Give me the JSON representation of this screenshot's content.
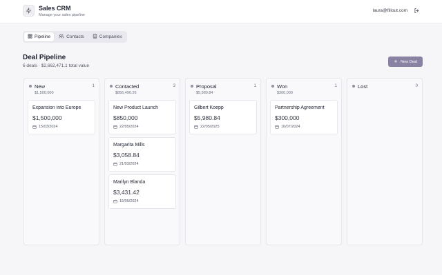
{
  "header": {
    "title": "Sales CRM",
    "subtitle": "Manage your sales pipeline",
    "user_email": "laura@fillout.com",
    "logo_icon": "lightning-icon",
    "logout_icon": "logout-icon"
  },
  "tabs": [
    {
      "label": "Pipeline",
      "icon": "grid-icon",
      "active": true
    },
    {
      "label": "Contacts",
      "icon": "users-icon",
      "active": false
    },
    {
      "label": "Companies",
      "icon": "building-icon",
      "active": false
    }
  ],
  "page": {
    "title": "Deal Pipeline",
    "summary": "6 deals · $2,662,471.1 total value",
    "new_deal_label": "New Deal"
  },
  "columns": [
    {
      "name": "New",
      "count": "1",
      "total": "$1,500,000",
      "deals": [
        {
          "name": "Expansion into Europe",
          "value": "$1,500,000",
          "date": "15/03/2024"
        }
      ]
    },
    {
      "name": "Contacted",
      "count": "3",
      "total": "$856,490.26",
      "deals": [
        {
          "name": "New Product Launch",
          "value": "$850,000",
          "date": "22/05/2024"
        },
        {
          "name": "Margarita Mills",
          "value": "$3,058.84",
          "date": "21/03/2024"
        },
        {
          "name": "Marilyn Blanda",
          "value": "$3,431.42",
          "date": "15/05/2024"
        }
      ]
    },
    {
      "name": "Proposal",
      "count": "1",
      "total": "$5,980.84",
      "deals": [
        {
          "name": "Gilbert Koepp",
          "value": "$5,980.84",
          "date": "22/05/2025"
        }
      ]
    },
    {
      "name": "Won",
      "count": "1",
      "total": "$300,000",
      "deals": [
        {
          "name": "Partnership Agreement",
          "value": "$300,000",
          "date": "10/07/2024"
        }
      ]
    },
    {
      "name": "Lost",
      "count": "0",
      "total": "",
      "deals": []
    }
  ],
  "colors": {
    "accent": "#8a82a3",
    "background": "#f6f6f8"
  }
}
